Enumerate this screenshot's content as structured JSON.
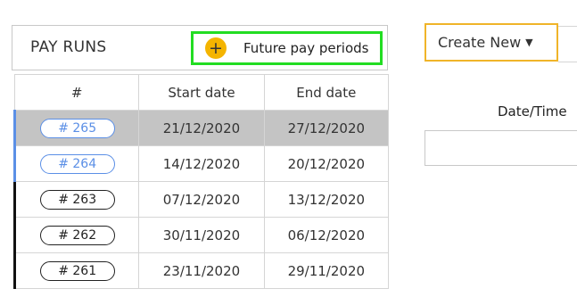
{
  "pay_runs": {
    "title": "PAY RUNS",
    "future_button_label": "Future pay periods",
    "columns": [
      "#",
      "Start date",
      "End date"
    ],
    "rows": [
      {
        "run": "# 265",
        "start": "21/12/2020",
        "end": "27/12/2020",
        "selected": true,
        "highlight": "blue"
      },
      {
        "run": "# 264",
        "start": "14/12/2020",
        "end": "20/12/2020",
        "selected": false,
        "highlight": "blue"
      },
      {
        "run": "# 263",
        "start": "07/12/2020",
        "end": "13/12/2020",
        "selected": false,
        "highlight": "black"
      },
      {
        "run": "# 262",
        "start": "30/11/2020",
        "end": "06/12/2020",
        "selected": false,
        "highlight": "black"
      },
      {
        "run": "# 261",
        "start": "23/11/2020",
        "end": "29/11/2020",
        "selected": false,
        "highlight": "black"
      }
    ]
  },
  "create_new": {
    "label": "Create New"
  },
  "datetime": {
    "label": "Date/Time",
    "value": ""
  },
  "colors": {
    "future_button_border": "#22dd22",
    "plus_circle": "#f4b400",
    "create_new_border": "#f0b429",
    "selected_row": "#c4c4c4",
    "link_blue": "#5b8fe6"
  },
  "icons": {
    "add": "plus-circle-icon",
    "dropdown": "caret-down-icon"
  }
}
